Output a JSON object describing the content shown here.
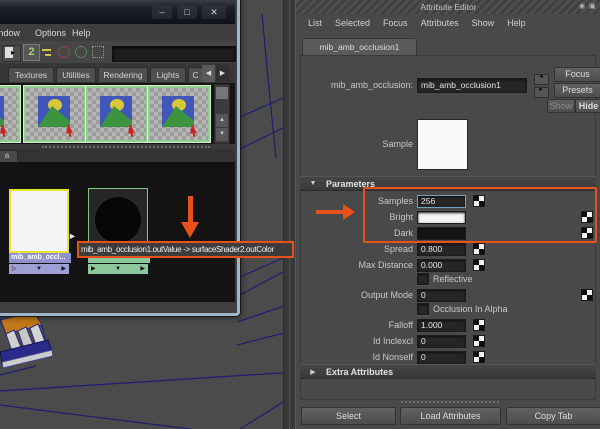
{
  "annotation": {
    "color": "#e8511a",
    "connection_tooltip": "mib_amb_occlusion1.outValue -> surfaceShader2.outColor"
  },
  "icons": {
    "down_triangle": "▼",
    "right_triangle": "▶",
    "right_triangle_hollow": "▷",
    "up_triangle": "▲",
    "left_triangle": "◀",
    "node_connector": "►",
    "pane_toggle": "2",
    "panel_menu_a": "◉",
    "panel_menu_b": "▣"
  },
  "hypershade": {
    "window_controls": {
      "minimize": "–",
      "maximize": "□",
      "close": "✕"
    },
    "menu": [
      "Window",
      "Options",
      "Help"
    ],
    "search_value": "",
    "tabs": [
      "Textures",
      "Utilities",
      "Rendering",
      "Lights",
      "C"
    ],
    "work_area_tab": "a",
    "white_node_label": "mib_amb_occl..."
  },
  "attribute_editor": {
    "title": "Attribute Editor",
    "menu": [
      "List",
      "Selected",
      "Focus",
      "Attributes",
      "Show",
      "Help"
    ],
    "tab": "mib_amb_occlusion1",
    "node": {
      "type_label": "mib_amb_occlusion:",
      "name": "mib_amb_occlusion1"
    },
    "buttons": {
      "focus": "Focus",
      "presets": "Presets",
      "show": "Show",
      "hide": "Hide"
    },
    "sample_label": "Sample",
    "parameters_title": "Parameters",
    "rows": [
      {
        "label": "Samples",
        "value": "256",
        "mapped": true
      },
      {
        "label": "Bright",
        "swatch": "#f2f2f2",
        "slider": 0.86
      },
      {
        "label": "Dark",
        "swatch": "#141414",
        "slider": 0.14
      },
      {
        "label": "Spread",
        "value": "0.800"
      },
      {
        "label": "Max Distance",
        "value": "0.000"
      },
      {
        "label": "Output Mode",
        "value": "0",
        "slider": 0.03
      },
      {
        "label": "Falloff",
        "value": "1.000"
      },
      {
        "label": "Id Inclexcl",
        "value": "0"
      },
      {
        "label": "Id Nonself",
        "value": "0"
      }
    ],
    "checkboxes": {
      "reflective": "Reflective",
      "occlusion_in_alpha": "Occlusion In Alpha"
    },
    "extra_attributes_title": "Extra Attributes",
    "footer_buttons": {
      "select": "Select",
      "load": "Load Attributes",
      "copy": "Copy Tab"
    }
  }
}
